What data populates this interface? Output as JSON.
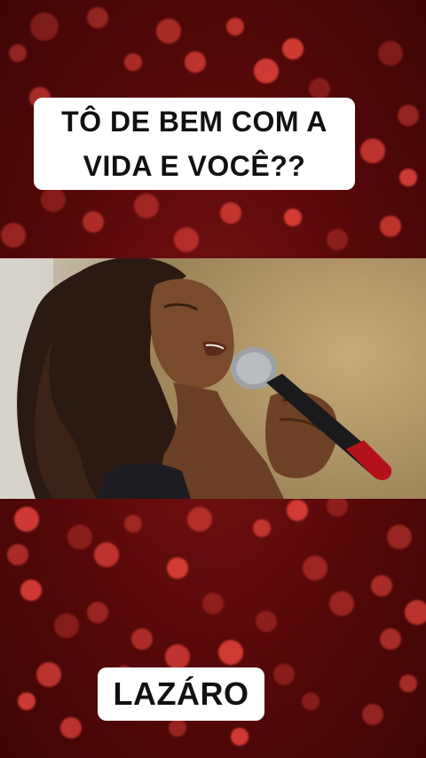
{
  "caption_top": {
    "line1": "TÔ DE BEM COM A",
    "line2": "VIDA E VOCÊ??"
  },
  "caption_bottom": {
    "text": "LAZÁRO"
  },
  "video": {
    "subject": "singer-with-microphone"
  },
  "colors": {
    "background": "#5a0a0c",
    "bokeh": "#e8453c",
    "caption_bg": "#ffffff",
    "caption_text": "#111111"
  }
}
